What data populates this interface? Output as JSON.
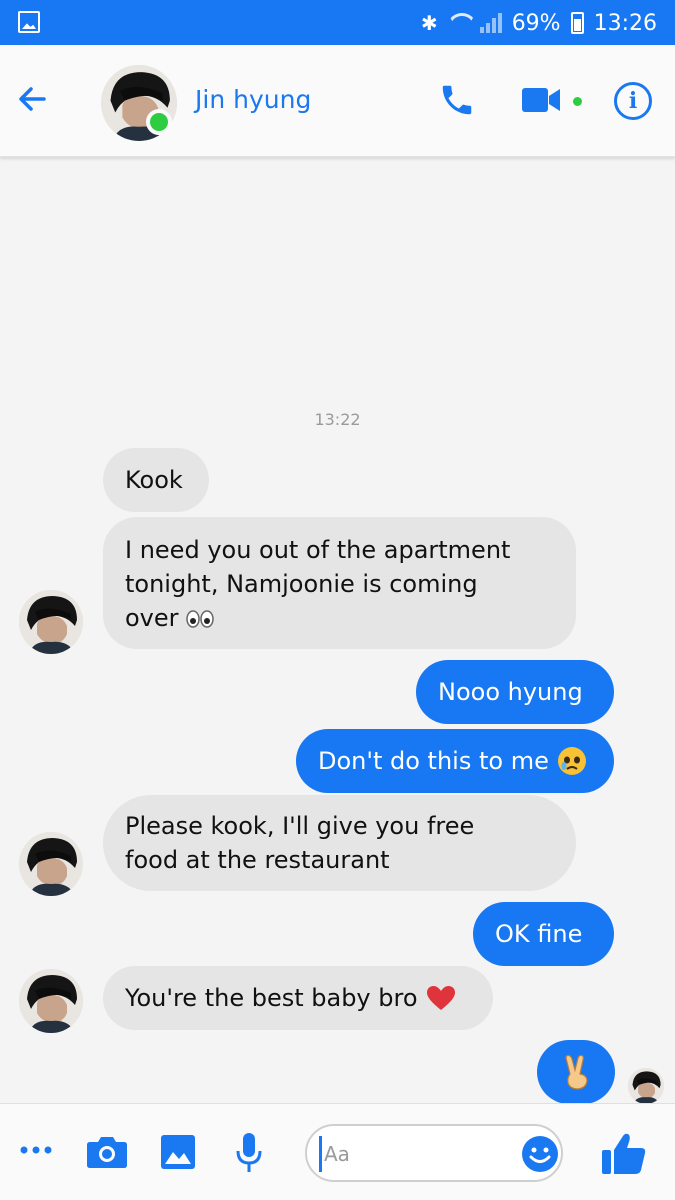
{
  "status_bar": {
    "battery": "69%",
    "time": "13:26"
  },
  "header": {
    "contact_name": "Jin hyung",
    "icons": [
      "back-arrow-icon",
      "phone-icon",
      "video-camera-icon",
      "info-icon"
    ],
    "accent_color": "#1877f2"
  },
  "conversation": {
    "timestamp": "13:22",
    "messages": [
      {
        "from": "them",
        "text": "Kook"
      },
      {
        "from": "them",
        "text_lines": [
          "I need you out of the apartment",
          "tonight, Namjoonie is coming",
          "over"
        ],
        "emoji": "eyes-emoji"
      },
      {
        "from": "me",
        "text": "Nooo hyung"
      },
      {
        "from": "me",
        "text": "Don't do this to me",
        "emoji": "crying-face-emoji"
      },
      {
        "from": "them",
        "text_lines": [
          "Please kook, I'll give you free",
          "food at the restaurant"
        ]
      },
      {
        "from": "me",
        "text": "OK fine"
      },
      {
        "from": "them",
        "text": "You're the best baby bro",
        "emoji": "red-heart-emoji"
      },
      {
        "from": "me",
        "emoji": "victory-hand-emoji"
      }
    ]
  },
  "composer": {
    "placeholder": "Aa",
    "icons": [
      "more-icon",
      "camera-icon",
      "gallery-icon",
      "microphone-icon",
      "smiley-icon",
      "thumbs-up-icon"
    ]
  }
}
